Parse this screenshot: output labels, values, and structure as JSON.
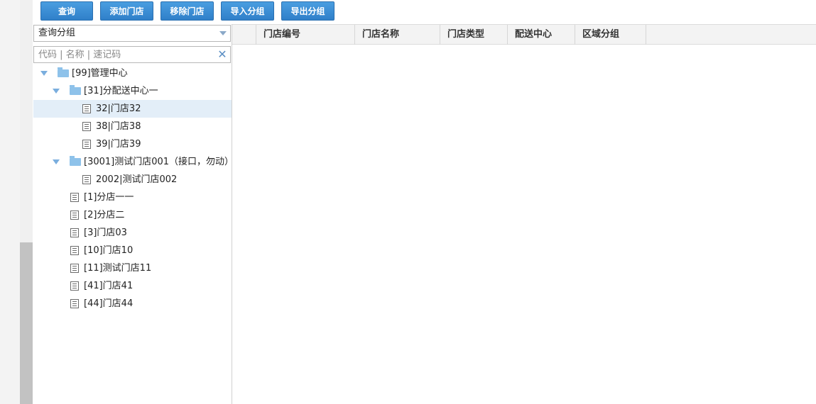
{
  "toolbar": {
    "query": "查询",
    "add_store": "添加门店",
    "remove_store": "移除门店",
    "import_group": "导入分组",
    "export_group": "导出分组"
  },
  "left_panel": {
    "group_select": {
      "value": "查询分组"
    },
    "search": {
      "placeholder": "代码 | 名称 | 速记码"
    },
    "tree": [
      {
        "label": "[99]管理中心",
        "type": "folder",
        "expanded": true
      },
      {
        "label": "[31]分配送中心一",
        "type": "folder",
        "expanded": true
      },
      {
        "label": "32|门店32",
        "type": "store",
        "selected": true
      },
      {
        "label": "38|门店38",
        "type": "store"
      },
      {
        "label": "39|门店39",
        "type": "store"
      },
      {
        "label": "[3001]测试门店001（接口，勿动）",
        "type": "folder",
        "expanded": true
      },
      {
        "label": "2002|测试门店002",
        "type": "store"
      },
      {
        "label": "[1]分店一一",
        "type": "store"
      },
      {
        "label": "[2]分店二",
        "type": "store"
      },
      {
        "label": "[3]门店03",
        "type": "store"
      },
      {
        "label": "[10]门店10",
        "type": "store"
      },
      {
        "label": "[11]测试门店11",
        "type": "store"
      },
      {
        "label": "[41]门店41",
        "type": "store"
      },
      {
        "label": "[44]门店44",
        "type": "store"
      }
    ]
  },
  "grid": {
    "columns": [
      "",
      "门店编号",
      "门店名称",
      "门店类型",
      "配送中心",
      "区域分组"
    ],
    "rows": []
  },
  "colors": {
    "button": "#3a8fd8",
    "selected_row": "#e3eef8",
    "folder": "#8ec2ea"
  }
}
